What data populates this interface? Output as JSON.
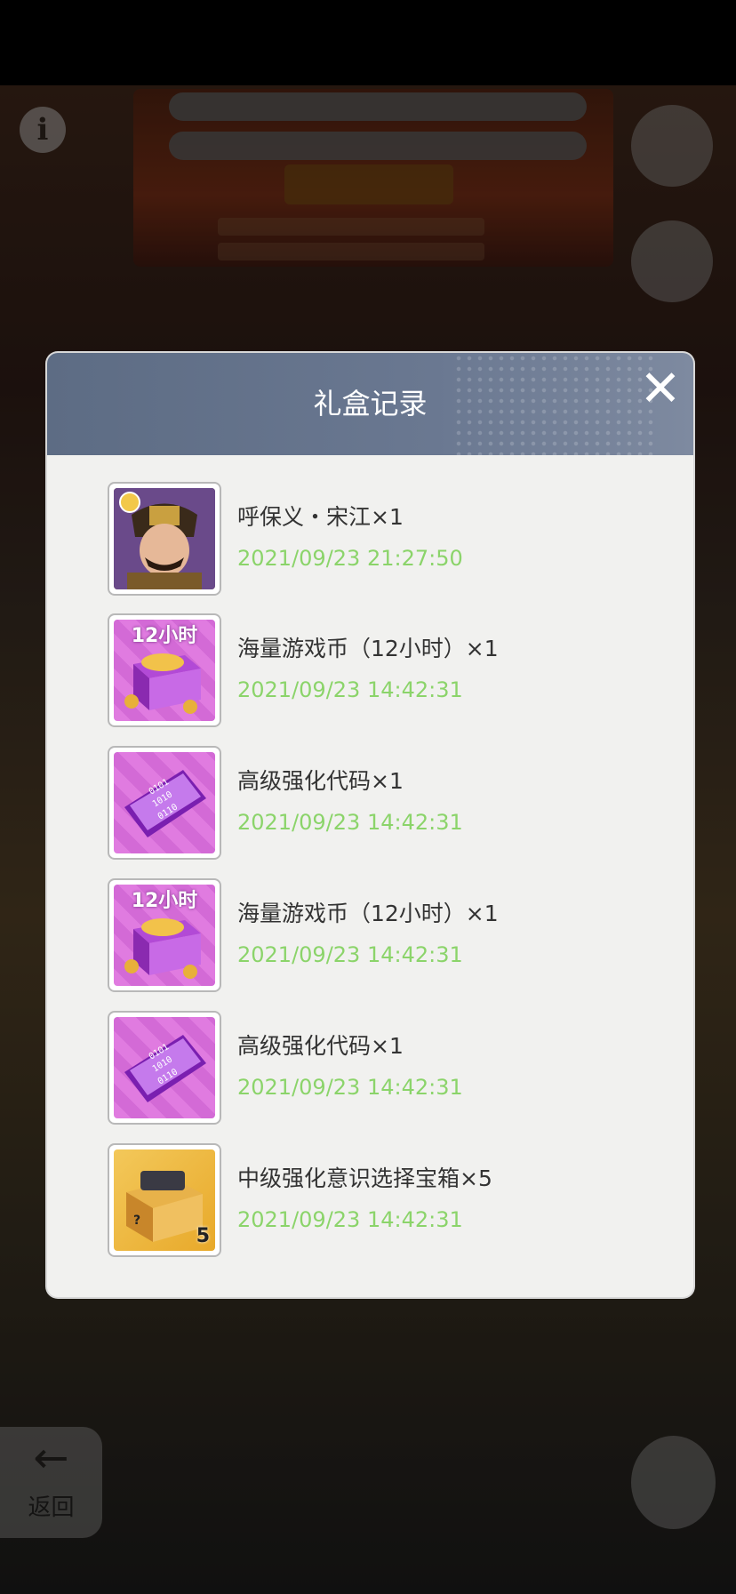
{
  "background": {
    "info_icon_glyph": "i",
    "back_button": {
      "arrow": "←",
      "label": "返回"
    }
  },
  "modal": {
    "title": "礼盒记录",
    "close_glyph": "✕",
    "records": [
      {
        "thumb": "hero-portrait",
        "badge": "",
        "count": "",
        "name": "呼保义・宋江×1",
        "time": "2021/09/23 21:27:50"
      },
      {
        "thumb": "coin-box",
        "badge": "12小时",
        "count": "",
        "name": "海量游戏币（12小时）×1",
        "time": "2021/09/23 14:42:31"
      },
      {
        "thumb": "code-card",
        "badge": "",
        "count": "",
        "name": "高级强化代码×1",
        "time": "2021/09/23 14:42:31"
      },
      {
        "thumb": "coin-box",
        "badge": "12小时",
        "count": "",
        "name": "海量游戏币（12小时）×1",
        "time": "2021/09/23 14:42:31"
      },
      {
        "thumb": "code-card",
        "badge": "",
        "count": "",
        "name": "高级强化代码×1",
        "time": "2021/09/23 14:42:31"
      },
      {
        "thumb": "treasure-chest",
        "badge": "",
        "count": "5",
        "name": "中级强化意识选择宝箱×5",
        "time": "2021/09/23 14:42:31"
      }
    ]
  }
}
